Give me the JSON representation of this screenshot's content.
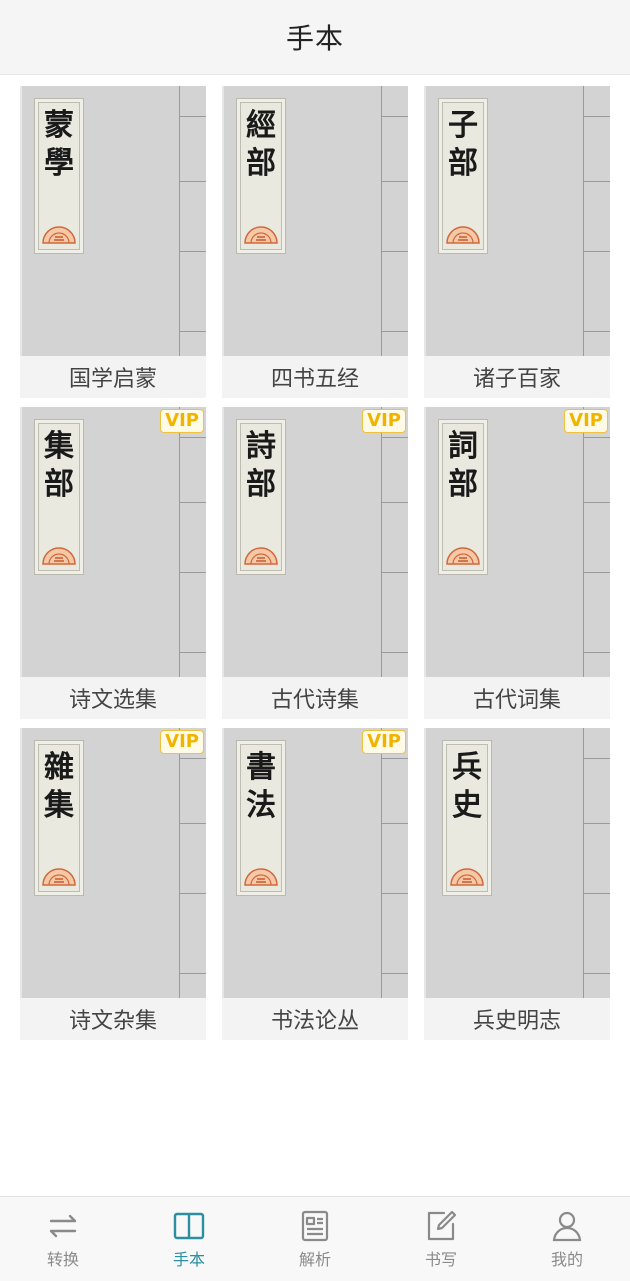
{
  "header": {
    "title": "手本"
  },
  "books": [
    {
      "chars": "蒙學",
      "caption": "国学启蒙",
      "vip": false,
      "vip_label": ""
    },
    {
      "chars": "經部",
      "caption": "四书五经",
      "vip": false,
      "vip_label": ""
    },
    {
      "chars": "子部",
      "caption": "诸子百家",
      "vip": false,
      "vip_label": ""
    },
    {
      "chars": "集部",
      "caption": "诗文选集",
      "vip": true,
      "vip_label": "VIP"
    },
    {
      "chars": "詩部",
      "caption": "古代诗集",
      "vip": true,
      "vip_label": "VIP"
    },
    {
      "chars": "詞部",
      "caption": "古代词集",
      "vip": true,
      "vip_label": "VIP"
    },
    {
      "chars": "雜集",
      "caption": "诗文杂集",
      "vip": true,
      "vip_label": "VIP"
    },
    {
      "chars": "書法",
      "caption": "书法论丛",
      "vip": true,
      "vip_label": "VIP"
    },
    {
      "chars": "兵史",
      "caption": "兵史明志",
      "vip": false,
      "vip_label": ""
    }
  ],
  "tabs": [
    {
      "label": "转换",
      "icon": "swap-icon",
      "active": false
    },
    {
      "label": "手本",
      "icon": "book-icon",
      "active": true
    },
    {
      "label": "解析",
      "icon": "document-icon",
      "active": false
    },
    {
      "label": "书写",
      "icon": "pencil-icon",
      "active": false
    },
    {
      "label": "我的",
      "icon": "user-icon",
      "active": false
    }
  ],
  "colors": {
    "accent": "#2a8fa0",
    "inactive": "#8a8a8a",
    "vip": "#f0b400",
    "cover": "#d3d3d3"
  }
}
